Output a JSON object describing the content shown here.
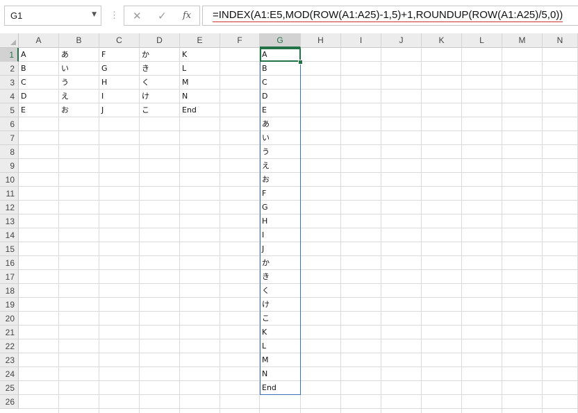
{
  "name_box": {
    "value": "G1",
    "dropdown_icon": "caret-down"
  },
  "formula_bar": {
    "separator": "⋮",
    "cancel_icon": "✕",
    "enter_icon": "✓",
    "fx_label": "fx",
    "formula": "=INDEX(A1:E5,MOD(ROW(A1:A25)-1,5)+1,ROUNDUP(ROW(A1:A25)/5,0))"
  },
  "columns": [
    "A",
    "B",
    "C",
    "D",
    "E",
    "F",
    "G",
    "H",
    "I",
    "J",
    "K",
    "L",
    "M",
    "N"
  ],
  "rows": [
    "1",
    "2",
    "3",
    "4",
    "5",
    "6",
    "7",
    "8",
    "9",
    "10",
    "11",
    "12",
    "13",
    "14",
    "15",
    "16",
    "17",
    "18",
    "19",
    "20",
    "21",
    "22",
    "23",
    "24",
    "25",
    "26"
  ],
  "selected_cell": {
    "column": "G",
    "row": "1"
  },
  "source_table": {
    "A": [
      "A",
      "B",
      "C",
      "D",
      "E"
    ],
    "B": [
      "あ",
      "い",
      "う",
      "え",
      "お"
    ],
    "C": [
      "F",
      "G",
      "H",
      "I",
      "J"
    ],
    "D": [
      "か",
      "き",
      "く",
      "け",
      "こ"
    ],
    "E": [
      "K",
      "L",
      "M",
      "N",
      "End"
    ]
  },
  "result_column_G": [
    "A",
    "B",
    "C",
    "D",
    "E",
    "あ",
    "い",
    "う",
    "え",
    "お",
    "F",
    "G",
    "H",
    "I",
    "J",
    "か",
    "き",
    "く",
    "け",
    "こ",
    "K",
    "L",
    "M",
    "N",
    "End"
  ],
  "colors": {
    "selection_green": "#217346",
    "spill_border_blue": "#3a6fb8",
    "formula_underline_red": "#d03030"
  }
}
